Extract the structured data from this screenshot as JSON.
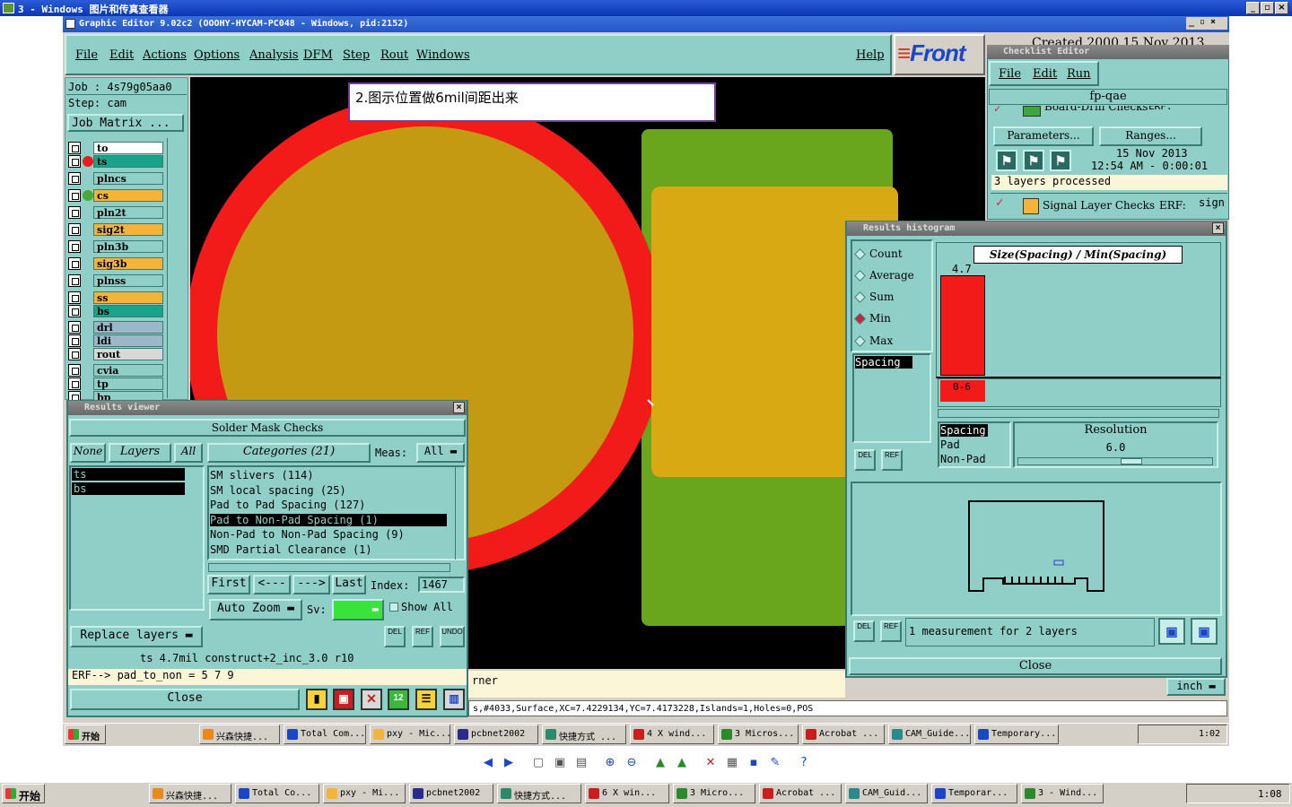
{
  "viewer_title": "3 - Windows 图片和传真查看器",
  "ge_title": "Graphic Editor 9.02c2  (OOOHY-HYCAM-PC048 - Windows, pid:2152)",
  "menu": [
    "File",
    "Edit",
    "Actions",
    "Options",
    "Analysis",
    "DFM",
    "Step",
    "Rout",
    "Windows"
  ],
  "help": "Help",
  "logo": "Front",
  "job": "Job  : 4s79g05aa0",
  "step": "Step: cam",
  "job_matrix": "Job Matrix ...",
  "layers": [
    {
      "name": "to",
      "color": "#ffffff",
      "dot": ""
    },
    {
      "name": "ts",
      "color": "#1aa38a",
      "dot": "#e61e1e"
    },
    {
      "name": "plncs",
      "color": "#8fcfc8",
      "dot": ""
    },
    {
      "name": "cs",
      "color": "#f4b43a",
      "dot": "#4aa83a"
    },
    {
      "name": "pln2t",
      "color": "#8fcfc8",
      "dot": ""
    },
    {
      "name": "sig2t",
      "color": "#f4b43a",
      "dot": ""
    },
    {
      "name": "pln3b",
      "color": "#8fcfc8",
      "dot": ""
    },
    {
      "name": "sig3b",
      "color": "#f4b43a",
      "dot": ""
    },
    {
      "name": "plnss",
      "color": "#8fcfc8",
      "dot": ""
    },
    {
      "name": "ss",
      "color": "#f4b43a",
      "dot": ""
    },
    {
      "name": "bs",
      "color": "#1aa38a",
      "dot": ""
    },
    {
      "name": "drl",
      "color": "#9ab8c8",
      "dot": ""
    },
    {
      "name": "ldi",
      "color": "#9ab8c8",
      "dot": ""
    },
    {
      "name": "rout",
      "color": "#d8d8d8",
      "dot": ""
    },
    {
      "name": "cvia",
      "color": "#8fcfc8",
      "dot": ""
    },
    {
      "name": "tp",
      "color": "#8fcfc8",
      "dot": ""
    },
    {
      "name": "bp",
      "color": "#8fcfc8",
      "dot": ""
    }
  ],
  "note": "2.图示位置做6mil间距出来",
  "checklist": {
    "title": "Checklist Editor",
    "menu": [
      "File",
      "Edit",
      "Run"
    ],
    "name": "fp-qae",
    "partial_header": "Board-Drill Checks",
    "erf": "ERF:",
    "parameters": "Parameters...",
    "ranges": "Ranges...",
    "date": "15 Nov 2013",
    "time": "12:54 AM - 0:00:01",
    "processed": "3 layers processed",
    "signal": "Signal Layer Checks",
    "sign": "sign",
    "behind": "Created 2000 15 Nov 2013"
  },
  "hist": {
    "title": "Results histogram",
    "options": [
      "Count",
      "Average",
      "Sum",
      "Min",
      "Max"
    ],
    "selected": "Min",
    "axis_title": "Size(Spacing) / Min(Spacing)",
    "bar_value": "4.7",
    "bin": "0-6",
    "list_items": [
      "Spacing"
    ],
    "type_items": [
      "Spacing",
      "Pad",
      "Non-Pad"
    ],
    "resolution_label": "Resolution",
    "resolution": "6.0",
    "summary": "1 measurement for 2 layers",
    "close": "Close",
    "del": "DEL",
    "ref": "REF"
  },
  "rv": {
    "title": "Results viewer",
    "header": "Solder Mask Checks",
    "none": "None",
    "layers": "Layers",
    "all": "All",
    "categories": "Categories (21)",
    "meas": "Meas:",
    "meas_value": "All",
    "layer_list": [
      "ts",
      "bs"
    ],
    "cats": [
      "SM slivers (114)",
      "SM local spacing (25)",
      "Pad to Pad Spacing (127)",
      "Pad to Non-Pad Spacing (1)",
      "Non-Pad to Non-Pad Spacing (9)",
      "SMD Partial Clearance (1)"
    ],
    "selected_cat": 3,
    "first": "First",
    "prev": "<---",
    "next": "--->",
    "last": "Last",
    "index_label": "Index:",
    "index": "1467",
    "auto_zoom": "Auto Zoom",
    "sv": "Sv:",
    "show_all": "Show All",
    "replace": "Replace layers",
    "del": "DEL",
    "ref": "REF",
    "undo": "UNDO",
    "status1": "ts 4.7mil  construct+2_inc_3.0  r10",
    "status2": "ERF--> pad_to_non = 5 7 9",
    "close": "Close"
  },
  "bottom": {
    "corner": "rner",
    "inch": "inch",
    "info": "s,#4033,Surface,XC=7.4229134,YC=7.4173228,Islands=1,Holes=0,POS"
  },
  "inner_taskbar": {
    "start": "开始",
    "items": [
      "兴森快捷...",
      "Total Com...",
      "pxy - Mic...",
      "pcbnet2002",
      "快捷方式 ...",
      "4 X wind...",
      "3 Micros...",
      "Acrobat ...",
      "CAM_Guide...",
      "Temporary..."
    ],
    "clock": "1:02"
  },
  "outer_taskbar": {
    "start": "开始",
    "items": [
      "兴森快捷...",
      "Total Co...",
      "pxy - Mi...",
      "pcbnet2002",
      "快捷方式...",
      "6 X win...",
      "3 Micro...",
      "Acrobat ...",
      "CAM_Guid...",
      "Temporar...",
      "3 - Wind..."
    ],
    "clock": "1:08"
  },
  "colors": {
    "teal": "#8fcfc8",
    "pad_red": "#f31a1a",
    "pad_olive": "#c49a12",
    "green": "#6aa51e",
    "gold": "#d8a912"
  }
}
